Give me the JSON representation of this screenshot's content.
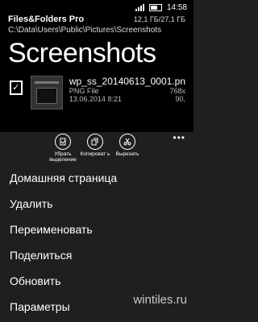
{
  "status_bar": {
    "time": "14:58"
  },
  "header": {
    "app_name": "Files&Folders Pro",
    "storage": "12,1 ГБ/27,1 ГБ",
    "path": "C:\\Data\\Users\\Public\\Pictures\\Screenshots",
    "title": "Screenshots"
  },
  "file": {
    "name": "wp_ss_20140613_0001.pn",
    "type": "PNG File",
    "date": "13.06.2014 8:21",
    "dims": "768x",
    "size": "90,"
  },
  "app_bar": {
    "buttons": [
      {
        "label": "Убрать выделение",
        "icon": "deselect-icon"
      },
      {
        "label": "Копироват ь",
        "icon": "copy-icon"
      },
      {
        "label": "Вырезать",
        "icon": "cut-icon"
      }
    ],
    "more": "•••"
  },
  "menu": [
    "Домашняя страница",
    "Удалить",
    "Переименовать",
    "Поделиться",
    "Обновить",
    "Параметры"
  ],
  "watermark": "wintiles.ru"
}
